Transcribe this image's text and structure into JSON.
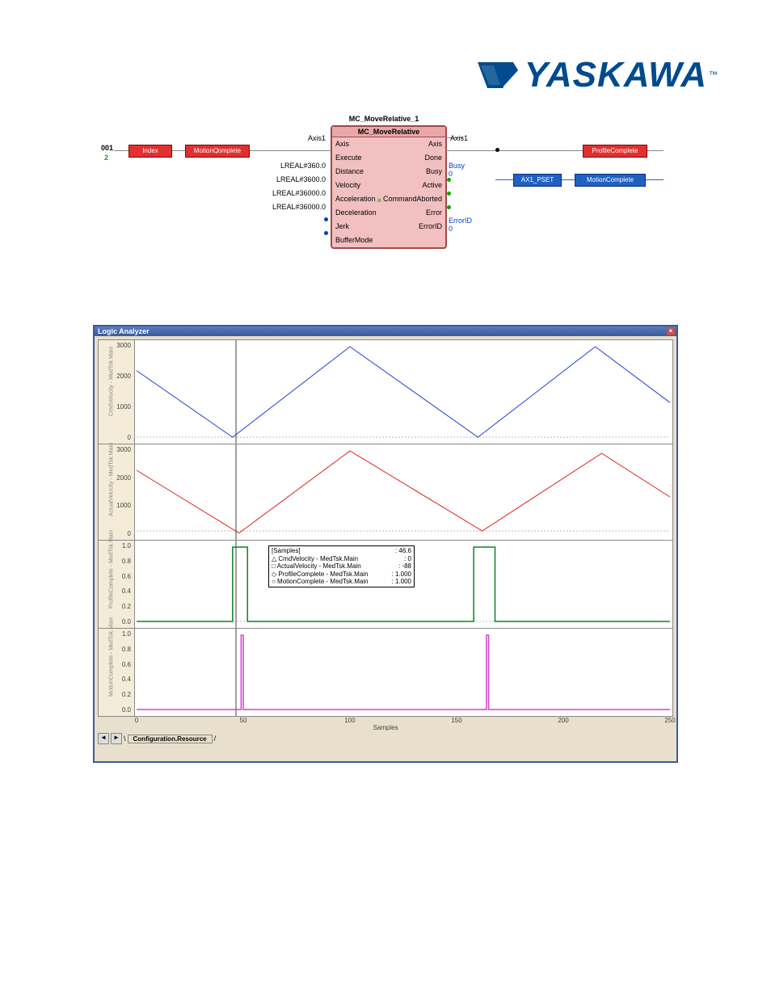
{
  "logo": {
    "text": "YASKAWA",
    "tm": "™"
  },
  "diagram": {
    "rung_number": "001",
    "rung_sub": "2",
    "fb_instance": "MC_MoveRelative_1",
    "fb_type": "MC_MoveRelative",
    "inputs": {
      "axis_label": "Axis",
      "axis_value": "Axis1",
      "execute": "Execute",
      "distance": "Distance",
      "distance_val": "LREAL#360.0",
      "velocity": "Velocity",
      "velocity_val": "LREAL#3600.0",
      "acceleration": "Acceleration",
      "acceleration_val": "LREAL#36000.0",
      "deceleration": "Deceleration",
      "deceleration_val": "LREAL#36000.0",
      "jerk": "Jerk",
      "buffermode": "BufferMode"
    },
    "outputs": {
      "axis_label": "Axis",
      "axis_value": "Axis1",
      "done": "Done",
      "busy": "Busy",
      "busy_wire": "Busy",
      "busy_val": "0",
      "active": "Active",
      "active_mid": "a",
      "cmd_aborted": "CommandAborted",
      "error": "Error",
      "errorid": "ErrorID",
      "errorid_wire": "ErrorID",
      "errorid_val": "0"
    },
    "left_contacts": {
      "index": "Index",
      "motion_complete": "MotionComplete"
    },
    "right_coils": {
      "profile_complete": "ProfileComplete",
      "ax1_pset": "AX1_PSET",
      "motion_complete": "MotionComplete"
    }
  },
  "analyzer": {
    "title": "Logic Analyzer",
    "tab": "Configuration.Resource",
    "x_label": "Samples",
    "x_ticks": [
      "0",
      "50",
      "100",
      "150",
      "200",
      "250"
    ],
    "info_box": {
      "header_label": "[Samples]",
      "header_val": ": 46.6",
      "rows": [
        {
          "icon": "△",
          "name": "CmdVelocity - MedTsk.Main",
          "val": ": 0"
        },
        {
          "icon": "□",
          "name": "ActualVelocity - MedTsk.Main",
          "val": ": -88"
        },
        {
          "icon": "◇",
          "name": "ProfileComplete - MedTsk.Main",
          "val": ": 1.000"
        },
        {
          "icon": "○",
          "name": "MotionComplete - MedTsk.Main",
          "val": ": 1.000"
        }
      ]
    },
    "panes": [
      {
        "label": "CmdVelocity - MedTsk.Main",
        "color": "#2040d0",
        "ticks": [
          "3000",
          "2000",
          "1000",
          "0"
        ]
      },
      {
        "label": "ActualVelocity - MedTsk.Main",
        "color": "#e02020",
        "ticks": [
          "3000",
          "2000",
          "1000",
          "0"
        ]
      },
      {
        "label": "ProfileComplete - MedTsk.Main",
        "color": "#108020",
        "ticks": [
          "1.0",
          "0.8",
          "0.6",
          "0.4",
          "0.2",
          "0.0"
        ]
      },
      {
        "label": "MotionComplete - MedTsk.Main",
        "color": "#d040d0",
        "ticks": [
          "1.0",
          "0.8",
          "0.6",
          "0.4",
          "0.2",
          "0.0"
        ]
      }
    ]
  },
  "chart_data": [
    {
      "type": "line",
      "title": "CmdVelocity",
      "xlabel": "Samples",
      "ylabel": "",
      "ylim": [
        0,
        3400
      ],
      "xlim": [
        0,
        250
      ],
      "x": [
        0,
        45,
        100,
        160,
        215,
        250
      ],
      "series": [
        {
          "name": "CmdVelocity - MedTsk.Main",
          "values": [
            2500,
            0,
            3400,
            0,
            3400,
            1300
          ]
        }
      ]
    },
    {
      "type": "line",
      "title": "ActualVelocity",
      "xlabel": "Samples",
      "ylabel": "",
      "ylim": [
        -100,
        3300
      ],
      "xlim": [
        0,
        250
      ],
      "x": [
        0,
        48,
        100,
        162,
        218,
        250
      ],
      "series": [
        {
          "name": "ActualVelocity - MedTsk.Main",
          "values": [
            2500,
            -88,
            3300,
            0,
            3200,
            1400
          ]
        }
      ]
    },
    {
      "type": "line",
      "title": "ProfileComplete",
      "xlabel": "Samples",
      "ylabel": "",
      "ylim": [
        0,
        1
      ],
      "xlim": [
        0,
        250
      ],
      "x": [
        0,
        45,
        45,
        52,
        52,
        158,
        158,
        168,
        168,
        250
      ],
      "series": [
        {
          "name": "ProfileComplete - MedTsk.Main",
          "values": [
            0,
            0,
            1,
            1,
            0,
            0,
            1,
            1,
            0,
            0
          ]
        }
      ]
    },
    {
      "type": "line",
      "title": "MotionComplete",
      "xlabel": "Samples",
      "ylabel": "",
      "ylim": [
        0,
        1
      ],
      "xlim": [
        0,
        250
      ],
      "x": [
        0,
        49,
        49,
        50,
        50,
        164,
        164,
        165,
        165,
        250
      ],
      "series": [
        {
          "name": "MotionComplete - MedTsk.Main",
          "values": [
            0,
            0,
            1,
            1,
            0,
            0,
            1,
            1,
            0,
            0
          ]
        }
      ]
    }
  ]
}
